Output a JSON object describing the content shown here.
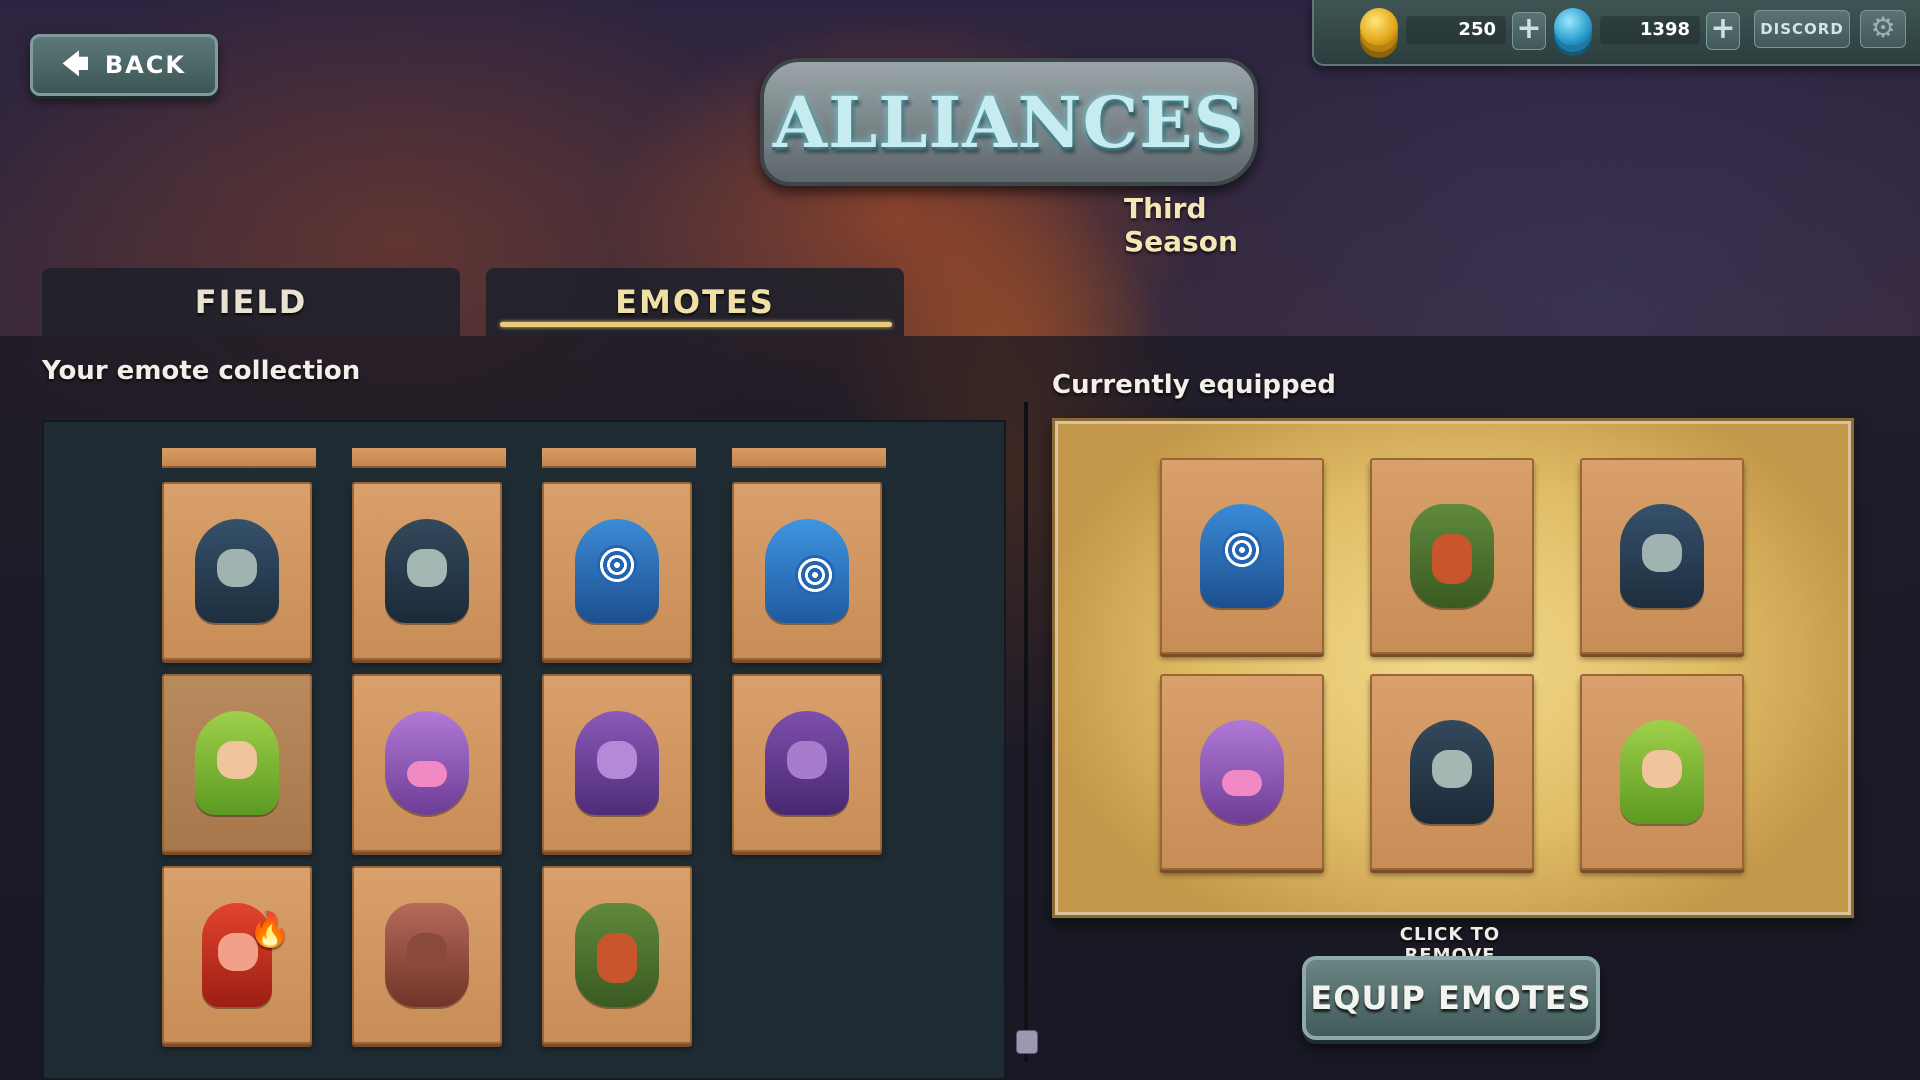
{
  "nav": {
    "back_label": "BACK"
  },
  "currency": {
    "gold_amount": "250",
    "gem_amount": "1398",
    "plus_label": "+",
    "discord_label": "DISCORD"
  },
  "header": {
    "logo_text": "ALLIANCES",
    "season": "Third Season"
  },
  "tabs": [
    {
      "label": "FIELD",
      "active": false
    },
    {
      "label": "EMOTES",
      "active": true
    }
  ],
  "collection": {
    "label": "Your emote collection",
    "emotes": [
      {
        "name": "hooded-sorcerer-gesturing-emote"
      },
      {
        "name": "hooded-sorcerer-thumbs-up-emote"
      },
      {
        "name": "blue-hooded-spiral-mask-emote"
      },
      {
        "name": "blue-hooded-spiral-peek-emote"
      },
      {
        "name": "green-haired-elf-emote"
      },
      {
        "name": "purple-monster-reading-book-emote"
      },
      {
        "name": "purple-horned-demoness-emote"
      },
      {
        "name": "purple-horned-demoness-pointing-emote"
      },
      {
        "name": "red-imp-fireball-emote"
      },
      {
        "name": "horned-minotaur-emote"
      },
      {
        "name": "red-bearded-dwarf-emote"
      }
    ]
  },
  "equipped": {
    "label": "Currently equipped",
    "emotes": [
      {
        "name": "blue-hooded-spiral-mask-emote"
      },
      {
        "name": "red-bearded-dwarf-emote"
      },
      {
        "name": "hooded-sorcerer-shrugging-emote"
      },
      {
        "name": "purple-monster-reading-book-emote"
      },
      {
        "name": "hooded-sorcerer-thumbs-up-emote"
      },
      {
        "name": "green-haired-elf-emote"
      }
    ],
    "hint": "CLICK TO REMOVE",
    "equip_button_label": "EQUIP EMOTES"
  },
  "colors": {
    "accent_gold": "#e6cc7b",
    "button_teal": "#4f6a6a",
    "parchment": "#e0bd66",
    "card": "#d29660",
    "panel_dark": "#1e2b33"
  }
}
